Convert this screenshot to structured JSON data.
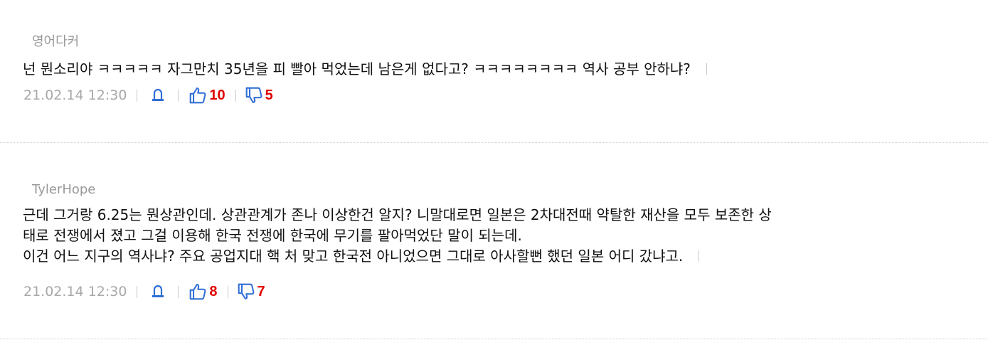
{
  "comments": [
    {
      "author": "영어다커",
      "lines": [
        "넌 뭔소리야 ㅋㅋㅋㅋㅋ 자그만치 35년을 피 빨아 먹었는데 남은게 없다고? ㅋㅋㅋㅋㅋㅋㅋㅋ 역사 공부 안하냐?"
      ],
      "date": "21.02.14 12:30",
      "likes": "10",
      "dislikes": "5"
    },
    {
      "author": "TylerHope",
      "lines": [
        "근데 그거랑 6.25는 뭔상관인데. 상관관계가 존나 이상한건 알지? 니말대로면 일본은 2차대전때 약탈한 재산을 모두 보존한 상",
        "태로 전쟁에서 졌고 그걸 이용해 한국 전쟁에 한국에 무기를 팔아먹었단 말이 되는데.",
        "이건 어느 지구의 역사냐? 주요 공업지대 핵 처 맞고 한국전 아니었으면 그대로 아사할뻔 했던 일본 어디 갔냐고."
      ],
      "date": "21.02.14 12:30",
      "likes": "8",
      "dislikes": "7"
    }
  ],
  "icons": {
    "report": "report-bell-icon",
    "like": "thumbs-up-icon",
    "dislike": "thumbs-down-icon"
  },
  "colors": {
    "icon_blue": "#2f6fd6",
    "count_red": "#e00000",
    "meta_gray": "#a8a8a8",
    "author_gray": "#999999"
  }
}
